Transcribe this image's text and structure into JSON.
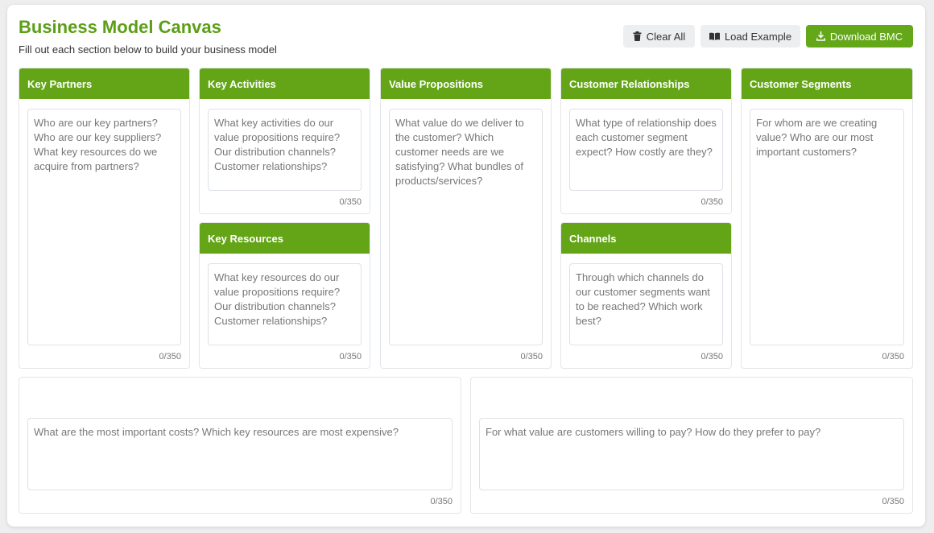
{
  "header": {
    "title": "Business Model Canvas",
    "subtitle": "Fill out each section below to build your business model"
  },
  "toolbar": {
    "clear_label": "Clear All",
    "load_label": "Load Example",
    "download_label": "Download BMC",
    "accent_color": "#64a719"
  },
  "sections": {
    "key_partners": {
      "title": "Key Partners",
      "placeholder": "Who are our key partners? Who are our key suppliers? What key resources do we acquire from partners?",
      "count": "0/350"
    },
    "key_activities": {
      "title": "Key Activities",
      "placeholder": "What key activities do our value propositions require? Our distribution channels? Customer relationships?",
      "count": "0/350"
    },
    "key_resources": {
      "title": "Key Resources",
      "placeholder": "What key resources do our value propositions require? Our distribution channels? Customer relationships?",
      "count": "0/350"
    },
    "value_propositions": {
      "title": "Value Propositions",
      "placeholder": "What value do we deliver to the customer? Which customer needs are we satisfying? What bundles of products/services?",
      "count": "0/350"
    },
    "customer_relationships": {
      "title": "Customer Relationships",
      "placeholder": "What type of relationship does each customer segment expect? How costly are they?",
      "count": "0/350"
    },
    "channels": {
      "title": "Channels",
      "placeholder": "Through which channels do our customer segments want to be reached? Which work best?",
      "count": "0/350"
    },
    "customer_segments": {
      "title": "Customer Segments",
      "placeholder": "For whom are we creating value? Who are our most important customers?",
      "count": "0/350"
    },
    "cost_structure": {
      "placeholder": "What are the most important costs? Which key resources are most expensive?",
      "count": "0/350"
    },
    "revenue_streams": {
      "placeholder": "For what value are customers willing to pay? How do they prefer to pay?",
      "count": "0/350"
    }
  }
}
